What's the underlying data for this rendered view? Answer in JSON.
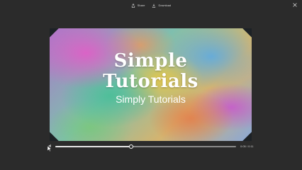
{
  "toolbar": {
    "share_label": "Share",
    "download_label": "Download",
    "share_icon": "share-icon",
    "download_icon": "download-icon",
    "close_icon": "close-icon"
  },
  "video": {
    "title_line1": "Simple",
    "title_line2": "Tutorials",
    "subtitle": "Simply Tutorials"
  },
  "player": {
    "current_time": "0:05",
    "duration": "0:11",
    "progress": 0.42,
    "volume_icon": "volume-icon"
  },
  "colors": {
    "background": "#2b2b2b",
    "text": "#d8d8d8",
    "seek_track": "#8a8a8a",
    "seek_played": "#e6e6e6"
  }
}
